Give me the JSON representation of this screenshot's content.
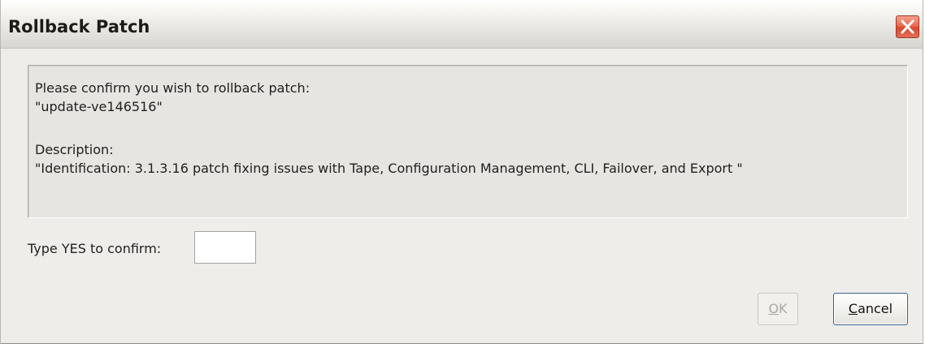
{
  "window": {
    "title": "Rollback Patch"
  },
  "message": {
    "confirm_prompt": "Please confirm you wish to rollback patch:",
    "patch_name": "\"update-ve146516\"",
    "description_label": "Description:",
    "description_text": "\"Identification: 3.1.3.16 patch fixing issues with Tape, Configuration Management, CLI, Failover, and Export \""
  },
  "confirm_field": {
    "label": "Type YES to confirm:",
    "value": ""
  },
  "buttons": {
    "ok": {
      "mnemonic": "O",
      "rest": "K",
      "enabled": false
    },
    "cancel": {
      "mnemonic": "C",
      "rest": "ancel"
    }
  },
  "icons": {
    "close": "close-icon"
  },
  "colors": {
    "close_button": "#d8492f",
    "cancel_border": "#3a5d92"
  }
}
